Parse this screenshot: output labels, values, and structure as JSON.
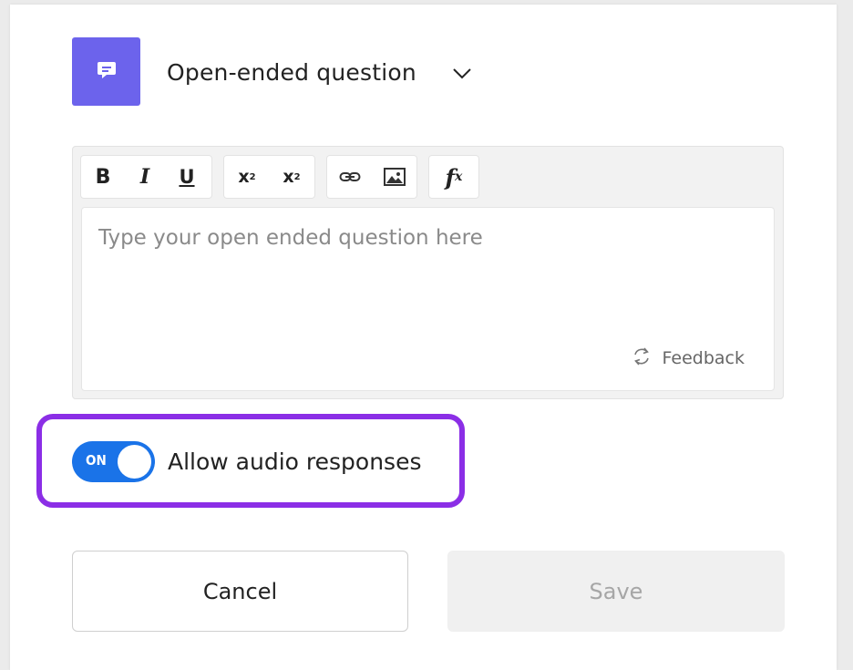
{
  "question_type": {
    "title": "Open-ended question",
    "icon": "chat-icon",
    "badge_color": "#6c63ec"
  },
  "toolbar": {
    "bold": "B",
    "italic": "I",
    "underline": "U",
    "superscript_base": "x",
    "superscript_mark": "2",
    "subscript_base": "x",
    "subscript_mark": "2",
    "formula_base": "f",
    "formula_sub": "x"
  },
  "editor": {
    "placeholder": "Type your open ended question here",
    "feedback_label": "Feedback"
  },
  "audio_responses": {
    "toggle_state": "ON",
    "label": "Allow audio responses",
    "toggle_color": "#1a73e8",
    "highlight_color": "#8b2ee6"
  },
  "actions": {
    "cancel_label": "Cancel",
    "save_label": "Save"
  }
}
